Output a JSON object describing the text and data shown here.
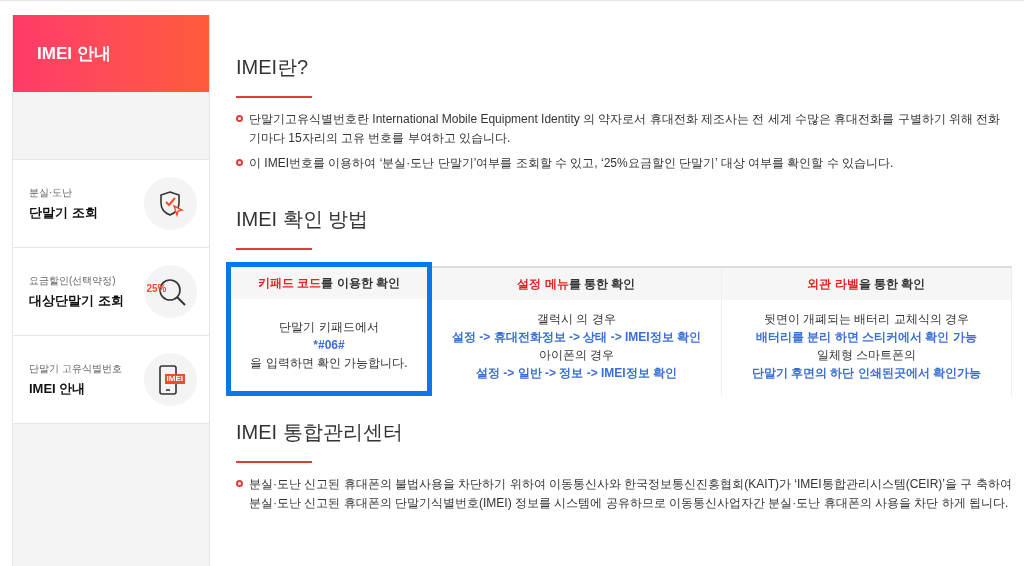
{
  "sidebar": {
    "title": "IMEI 안내",
    "items": [
      {
        "caption": "분실·도난",
        "label": "단말기 조회",
        "kind": "shield"
      },
      {
        "caption": "요금할인(선택약정)",
        "label": "대상단말기 조회",
        "kind": "magnifier",
        "badge": "25%"
      },
      {
        "caption": "단말기 고유식별번호",
        "label": "IMEI 안내",
        "kind": "phone",
        "badge": "IMEI"
      }
    ]
  },
  "sections": [
    {
      "title": "IMEI란?",
      "bullets": [
        "단말기고유식별번호란 International Mobile Equipment Identity 의 약자로서 휴대전화 제조사는 전 세계 수많은 휴대전화를 구별하기 위해 전화기마다 15자리의 고유 번호를 부여하고 있습니다.",
        "이 IMEI번호를 이용하여 ‘분실·도난 단말기’여부를 조회할 수 있고, ‘25%요금할인 단말기’ 대상 여부를 확인할 수 있습니다."
      ]
    },
    {
      "title": "IMEI 확인 방법",
      "methods": [
        {
          "accent": "키패드 코드",
          "rest": "를 이용한 확인",
          "highlighted": true,
          "lines": [
            {
              "kind": "plain",
              "text": "단말기 키패드에서"
            },
            {
              "kind": "link",
              "text": "*#06#"
            },
            {
              "kind": "plain",
              "text": "을 입력하면 확인 가능합니다."
            }
          ]
        },
        {
          "accent": "설정 메뉴",
          "rest": "를 통한 확인",
          "highlighted": false,
          "lines": [
            {
              "kind": "plain",
              "text": "갤럭시 의 경우"
            },
            {
              "kind": "link",
              "text": "설정 -> 휴대전화정보 -> 상태 -> IMEI정보 확인"
            },
            {
              "kind": "plain",
              "text": "아이폰의 경우"
            },
            {
              "kind": "link",
              "text": "설정 -> 일반 -> 정보 -> IMEI정보 확인"
            }
          ]
        },
        {
          "accent": "외관 라벨",
          "rest": "을 통한 확인",
          "highlighted": false,
          "lines": [
            {
              "kind": "plain",
              "text": "뒷면이 개폐되는 배터리 교체식의 경우"
            },
            {
              "kind": "link",
              "text": "배터리를 분리 하면 스티커에서 확인 가능"
            },
            {
              "kind": "plain",
              "text": "일체형 스마트폰의"
            },
            {
              "kind": "link",
              "text": "단말기 후면의 하단 인쇄된곳에서 확인가능"
            }
          ]
        }
      ]
    },
    {
      "title": "IMEI 통합관리센터",
      "bullets": [
        "분실·도난 신고된 휴대폰의 불법사용을 차단하기 위하여 이동통신사와 한국정보통신진흥협회(KAIT)가 ‘IMEI통합관리시스템(CEIR)’을 구 축하여 분실·도난 신고된 휴대폰의 단말기식별번호(IMEI) 정보를 시스템에 공유하므로 이동통신사업자간 분실·도난 휴대폰의 사용을 차단 하게 됩니다."
      ]
    }
  ]
}
